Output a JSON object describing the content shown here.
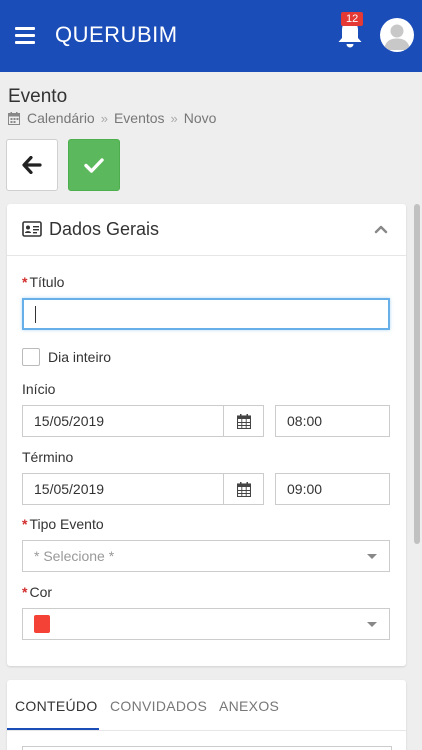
{
  "app": {
    "brand": "QUERUBIM",
    "notifications_count": "12"
  },
  "page": {
    "title": "Evento",
    "breadcrumb": [
      "Calendário",
      "Eventos",
      "Novo"
    ]
  },
  "section": {
    "title": "Dados Gerais"
  },
  "form": {
    "titulo_label": "Título",
    "titulo_value": "",
    "dia_inteiro_label": "Dia inteiro",
    "dia_inteiro_checked": false,
    "inicio_label": "Início",
    "inicio_date": "15/05/2019",
    "inicio_time": "08:00",
    "termino_label": "Término",
    "termino_date": "15/05/2019",
    "termino_time": "09:00",
    "tipo_evento_label": "Tipo Evento",
    "tipo_evento_placeholder": "* Selecione *",
    "cor_label": "Cor",
    "cor_value": "#f44336"
  },
  "tabs": [
    {
      "label": "CONTEÚDO",
      "active": true
    },
    {
      "label": "CONVIDADOS",
      "active": false
    },
    {
      "label": "ANEXOS",
      "active": false
    }
  ],
  "colors": {
    "appbar": "#1a4db8",
    "save": "#5cb85c",
    "required": "#d32f2f",
    "badge": "#e53935"
  },
  "icons": {
    "menu": "hamburger-icon",
    "notifications": "bell-icon",
    "user": "avatar-icon",
    "breadcrumb": "calendar-icon",
    "back": "arrow-left-icon",
    "save": "check-icon",
    "section": "id-card-icon",
    "collapse": "chevron-up-icon",
    "date_picker": "calendar-icon",
    "select": "caret-down-icon"
  }
}
